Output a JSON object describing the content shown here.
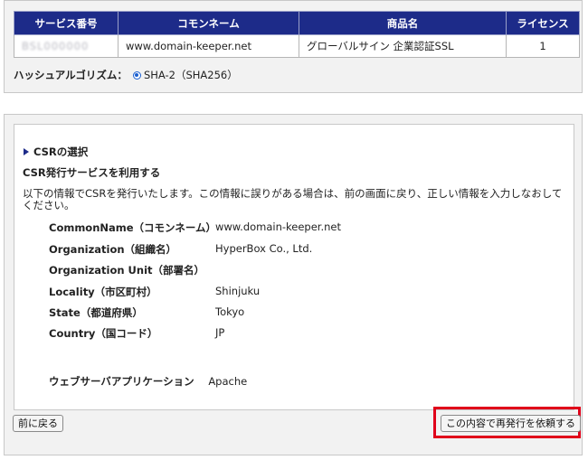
{
  "service_table": {
    "headers": [
      "サービス番号",
      "コモンネーム",
      "商品名",
      "ライセンス"
    ],
    "row": {
      "service_number": "BSL000000",
      "common_name": "www.domain-keeper.net",
      "product_name": "グローバルサイン 企業認証SSL",
      "license": "1"
    }
  },
  "hash": {
    "label": "ハッシュアルゴリズム：",
    "option": "SHA-2（SHA256）",
    "selected": true
  },
  "csr": {
    "section_title": "CSRの選択",
    "subtitle": "CSR発行サービスを利用する",
    "description": "以下の情報でCSRを発行いたします。この情報に誤りがある場合は、前の画面に戻り、正しい情報を入力しなおしてください。",
    "fields": [
      {
        "label": "CommonName（コモンネーム）",
        "value": "www.domain-keeper.net"
      },
      {
        "label": "Organization（組織名）",
        "value": "HyperBox Co., Ltd."
      },
      {
        "label": "Organization Unit（部署名）",
        "value": ""
      },
      {
        "label": "Locality（市区町村）",
        "value": "Shinjuku"
      },
      {
        "label": "State（都道府県）",
        "value": "Tokyo"
      },
      {
        "label": "Country（国コード）",
        "value": "JP"
      }
    ],
    "web_server": {
      "label": "ウェブサーバアプリケーション",
      "value": "Apache"
    }
  },
  "buttons": {
    "back": "前に戻る",
    "request": "この内容で再発行を依頼する"
  },
  "colors": {
    "header_bg": "#1d2b89",
    "highlight": "#e0001a"
  }
}
